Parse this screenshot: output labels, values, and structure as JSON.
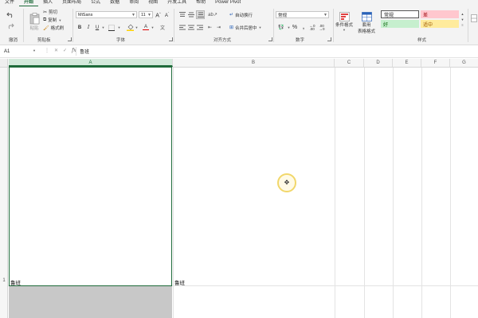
{
  "menu": {
    "tabs": [
      "文件",
      "开始",
      "插入",
      "页面布局",
      "公式",
      "数据",
      "审阅",
      "视图",
      "开发工具",
      "帮助",
      "Power Pivot"
    ],
    "active_index": 1
  },
  "ribbon": {
    "undo_group": {
      "label": "撤消"
    },
    "clipboard": {
      "label": "剪贴板",
      "paste": "粘贴",
      "cut": "剪切",
      "copy": "复制",
      "format_painter": "格式刷"
    },
    "font": {
      "label": "字体",
      "font_name": "MiSans",
      "font_size": "11"
    },
    "alignment": {
      "label": "对齐方式",
      "wrap_text": "自动换行",
      "merge_center": "合并后居中"
    },
    "number": {
      "label": "数字",
      "format": "常规"
    },
    "styles": {
      "label": "样式",
      "conditional_formatting": "条件格式",
      "format_as_table_line1": "套用",
      "format_as_table_line2": "表格格式",
      "normal": "常规",
      "bad": "差",
      "good": "好",
      "neutral": "适中"
    }
  },
  "formula_bar": {
    "name_box": "A1",
    "fx_label": "fx",
    "content": "鲁班"
  },
  "grid": {
    "columns": [
      "A",
      "B",
      "C",
      "D",
      "E",
      "F",
      "G"
    ],
    "selected_column": "A",
    "rows": [
      "1"
    ],
    "cells": {
      "A1": "鲁班",
      "B1": "鲁班"
    }
  },
  "colors": {
    "accent": "#1e6b3a",
    "bad_bg": "#ffc7ce",
    "good_bg": "#c6efce",
    "neutral_bg": "#ffeb9c"
  }
}
